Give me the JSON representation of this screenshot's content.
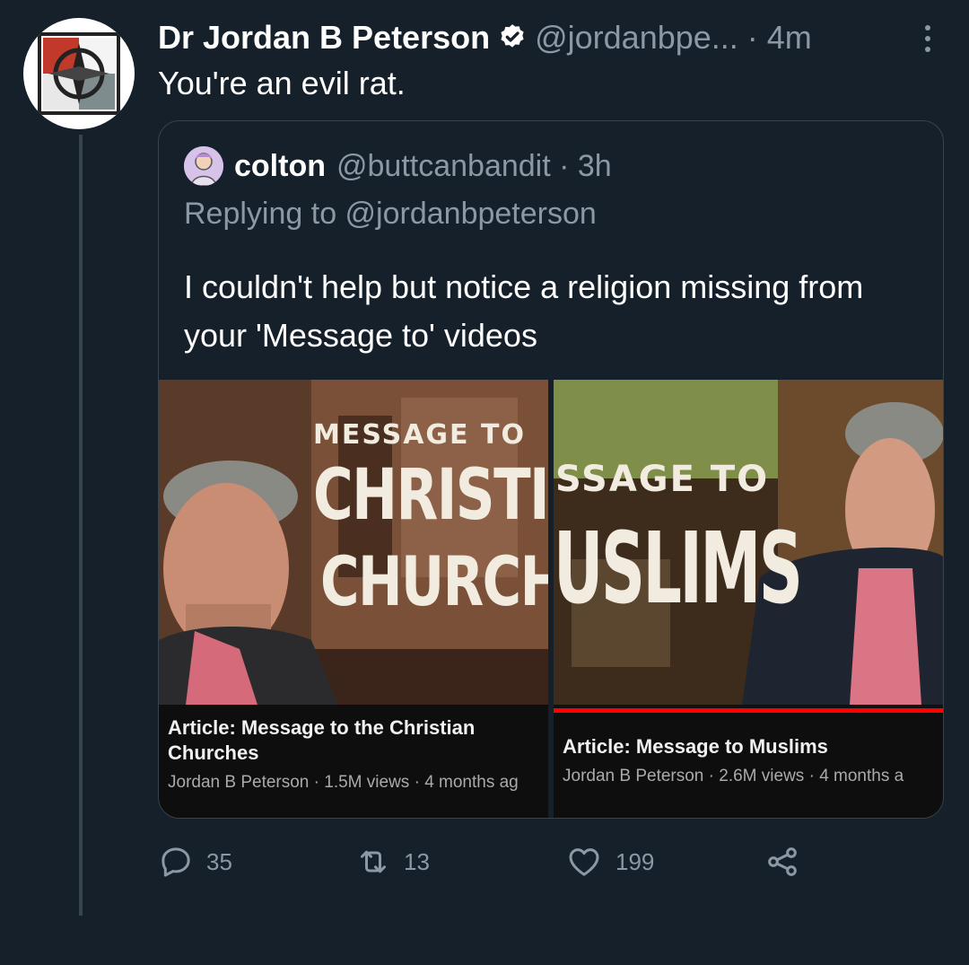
{
  "tweet": {
    "display_name": "Dr Jordan B Peterson",
    "handle": "@jordanbpe...",
    "time": "4m",
    "text": "You're an evil rat."
  },
  "quoted_tweet": {
    "display_name": "colton",
    "handle": "@buttcanbandit",
    "time": "3h",
    "replying_to": "Replying to @jordanbpeterson",
    "text": "I couldn't help but notice a religion missing from your 'Message to' videos"
  },
  "videos": [
    {
      "thumb_line1": "MESSAGE TO",
      "thumb_line2": "CHRISTI",
      "thumb_line3": "CHURCH",
      "title": "Article: Message to the Christian Churches",
      "channel": "Jordan B Peterson",
      "views": "1.5M views",
      "age": "4 months ag"
    },
    {
      "thumb_line1": "SSAGE TO",
      "thumb_line2": "USLIMS",
      "title": "Article: Message to Muslims",
      "channel": "Jordan B Peterson",
      "views": "2.6M views",
      "age": "4 months a",
      "watch_progress": 1.0
    }
  ],
  "actions": {
    "replies": "35",
    "retweets": "13",
    "likes": "199"
  },
  "colors": {
    "background": "#15202b",
    "secondary_text": "#8b98a5",
    "verified": "#ffffff",
    "progress": "#ff0000"
  }
}
